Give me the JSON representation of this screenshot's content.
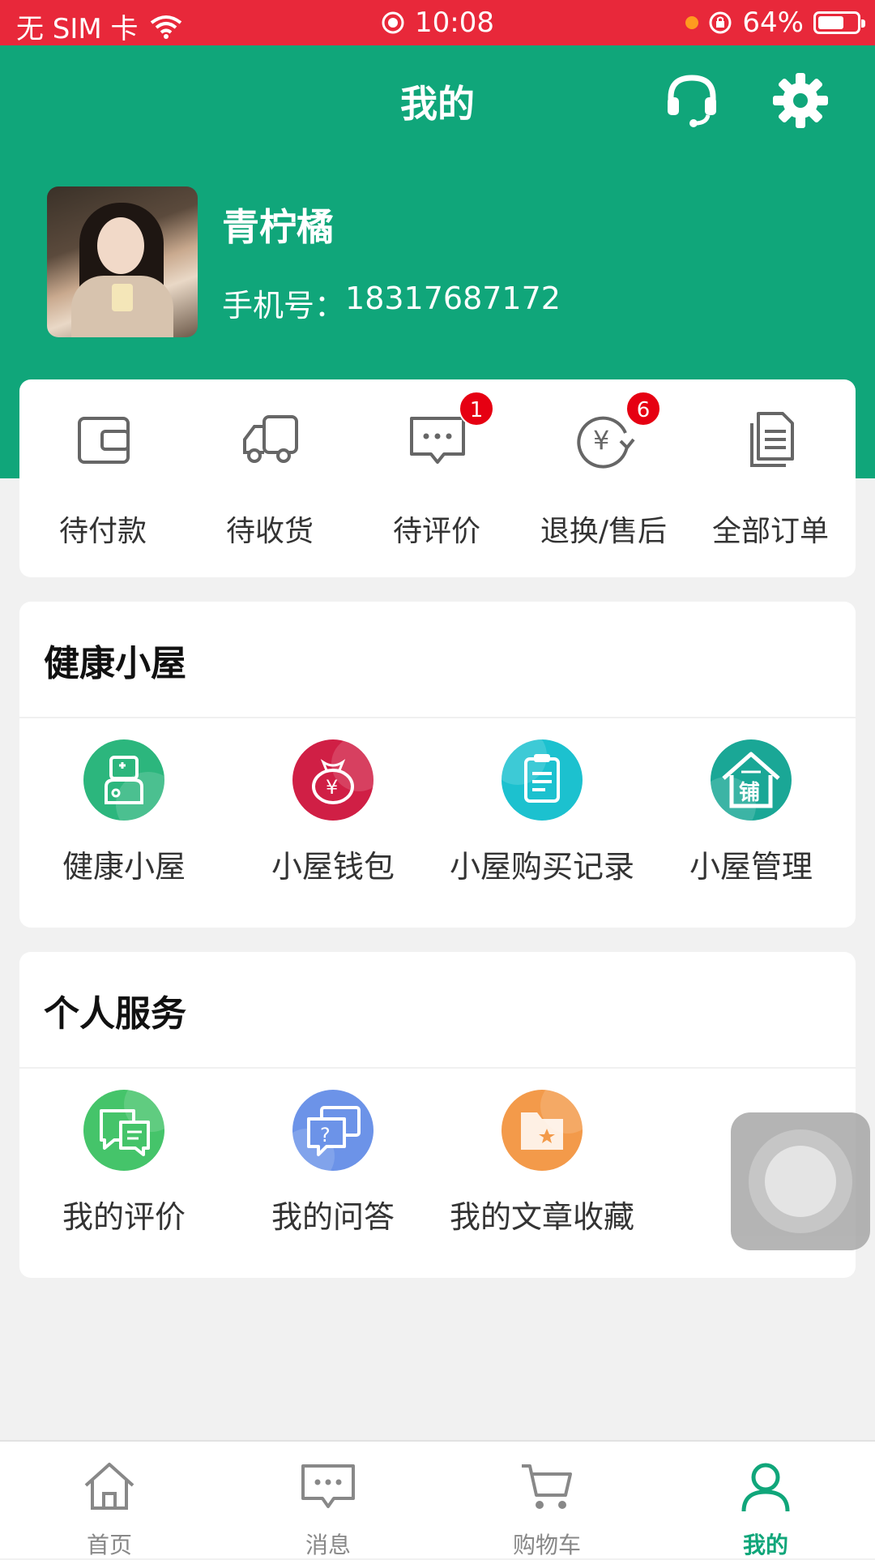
{
  "status_bar": {
    "carrier": "无 SIM 卡",
    "time": "10:08",
    "battery": "64%",
    "battery_level_percent": 64
  },
  "header": {
    "title": "我的",
    "customer_service_icon": "headset-icon",
    "settings_icon": "gear-icon",
    "username": "青柠橘",
    "phone_label": "手机号：",
    "phone_number": "18317687172"
  },
  "orders": [
    {
      "label": "待付款",
      "icon": "wallet-icon",
      "badge": ""
    },
    {
      "label": "待收货",
      "icon": "truck-icon",
      "badge": ""
    },
    {
      "label": "待评价",
      "icon": "chat-bubble-icon",
      "badge": "1"
    },
    {
      "label": "退换/售后",
      "icon": "refund-icon",
      "badge": "6"
    },
    {
      "label": "全部订单",
      "icon": "document-icon",
      "badge": ""
    }
  ],
  "health_house": {
    "title": "健康小屋",
    "items": [
      {
        "label": "健康小屋",
        "icon": "doctor-icon",
        "color": "#2cb67d"
      },
      {
        "label": "小屋钱包",
        "icon": "money-bag-icon",
        "color": "#d01f45"
      },
      {
        "label": "小屋购买记录",
        "icon": "clipboard-icon",
        "color": "#1cc1cf"
      },
      {
        "label": "小屋管理",
        "icon": "shop-house-icon",
        "color": "#1aa796",
        "icon_text": "铺"
      }
    ]
  },
  "personal_services": {
    "title": "个人服务",
    "items": [
      {
        "label": "我的评价",
        "icon": "review-icon",
        "color": "#45c46a"
      },
      {
        "label": "我的问答",
        "icon": "qa-icon",
        "color": "#6c93e8"
      },
      {
        "label": "我的文章收藏",
        "icon": "folder-star-icon",
        "color": "#f39a4a"
      }
    ]
  },
  "tabbar": [
    {
      "label": "首页",
      "icon": "home-icon",
      "active": false
    },
    {
      "label": "消息",
      "icon": "message-icon",
      "active": false
    },
    {
      "label": "购物车",
      "icon": "cart-icon",
      "active": false
    },
    {
      "label": "我的",
      "icon": "person-icon",
      "active": true
    }
  ],
  "colors": {
    "primary": "#10a67a",
    "status_bar": "#e8283a",
    "badge": "#e60012"
  }
}
